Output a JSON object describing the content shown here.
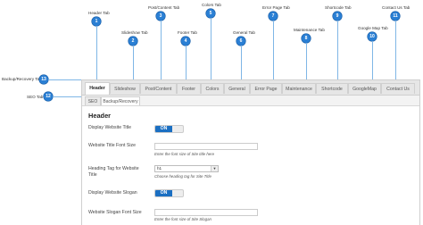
{
  "annotations": [
    {
      "num": "1",
      "label": "Header Tab"
    },
    {
      "num": "2",
      "label": "Slideshow Tab"
    },
    {
      "num": "3",
      "label": "Post/Content Tab"
    },
    {
      "num": "4",
      "label": "Footer Tab"
    },
    {
      "num": "5",
      "label": "Colors Tab"
    },
    {
      "num": "6",
      "label": "General Tab"
    },
    {
      "num": "7",
      "label": "Error Page Tab"
    },
    {
      "num": "8",
      "label": "Maintenance Tab"
    },
    {
      "num": "9",
      "label": "Shortcode Tab"
    },
    {
      "num": "10",
      "label": "Google Map Tab"
    },
    {
      "num": "11",
      "label": "Contact Us Tab"
    },
    {
      "num": "12",
      "label": "SEO Tab"
    },
    {
      "num": "13",
      "label": "Backup/Recovery Tab"
    }
  ],
  "tabs": [
    "Header",
    "Slideshow",
    "Post/Content",
    "Footer",
    "Colors",
    "General",
    "Error Page",
    "Maintenance",
    "Shortcode",
    "GoogleMap",
    "Contact Us"
  ],
  "subtabs": [
    "SEO",
    "Backup/Recovery"
  ],
  "section": {
    "title": "Header"
  },
  "form": {
    "display_title_label": "Display Website Title",
    "display_title_toggle": "ON",
    "title_font_size_label": "Website Title Font Size",
    "title_font_size_hint": "Enter the font size of Site title here",
    "heading_tag_label_line1": "Heading Tag for Website",
    "heading_tag_label_line2": "Title",
    "heading_tag_value": "h1",
    "heading_tag_hint": "Choose heading tag for Site Title",
    "display_slogan_label": "Display Website Slogan",
    "display_slogan_toggle": "ON",
    "slogan_font_size_label": "Website Slogan Font Size",
    "slogan_font_size_hint": "Enter the font size of Site Slogan"
  },
  "colors": {
    "badge": "#2a7fd4",
    "toggle_on": "#1b6fc2"
  }
}
